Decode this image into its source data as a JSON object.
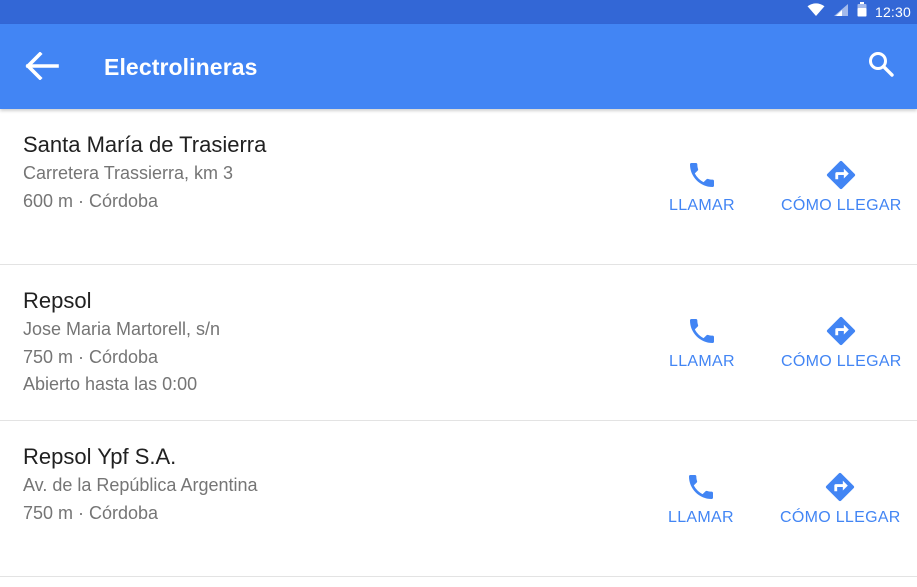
{
  "status_bar": {
    "time": "12:30"
  },
  "app_bar": {
    "title": "Electrolineras",
    "back_icon": "arrow-back-icon",
    "search_icon": "search-icon"
  },
  "colors": {
    "status_bar": "#3367d6",
    "app_bar": "#4285f4",
    "accent": "#4285f4",
    "primary_text": "#212121",
    "secondary_text": "#757575"
  },
  "stations": [
    {
      "name": "Santa María de Trasierra",
      "address": "Carretera Trassierra, km 3",
      "distance": "600 m · Córdoba",
      "hours": null,
      "call_label": "LLAMAR",
      "directions_label": "CÓMO LLEGAR"
    },
    {
      "name": "Repsol",
      "address": "Jose Maria Martorell, s/n",
      "distance": "750 m · Córdoba",
      "hours": "Abierto hasta las 0:00",
      "call_label": "LLAMAR",
      "directions_label": "CÓMO LLEGAR"
    },
    {
      "name": "Repsol Ypf S.A.",
      "address": "Av. de la República Argentina",
      "distance": "750 m · Córdoba",
      "hours": null,
      "call_label": "LLAMAR",
      "directions_label": "CÓMO LLEGAR"
    }
  ]
}
